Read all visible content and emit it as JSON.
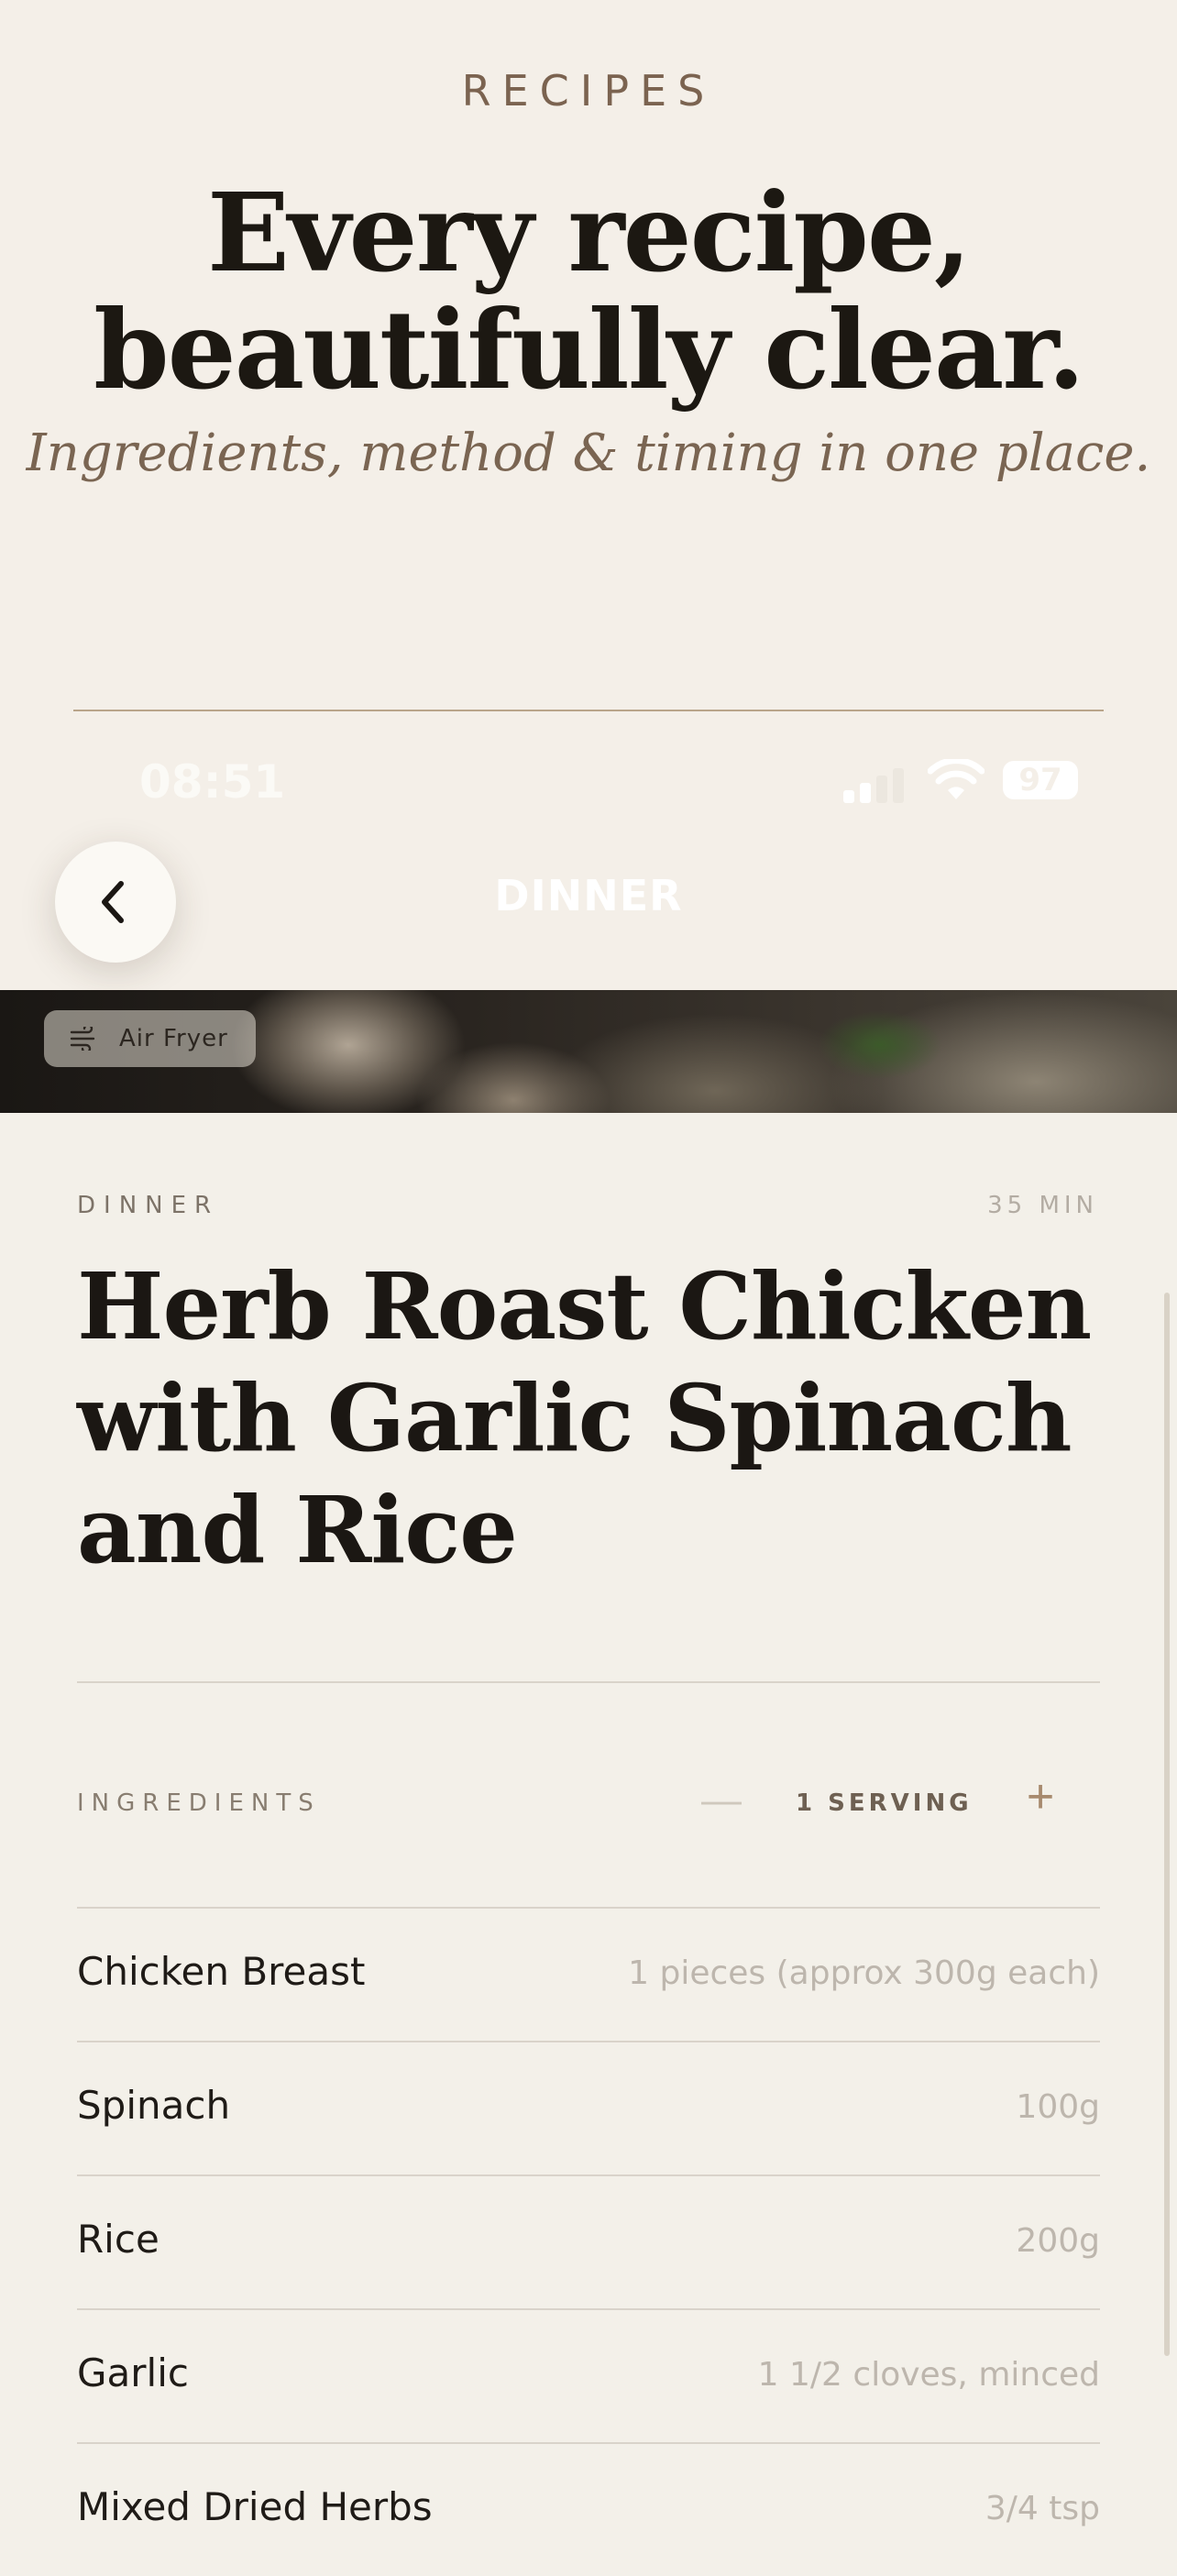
{
  "promo": {
    "eyebrow": "RECIPES",
    "headline_line1": "Every recipe,",
    "headline_line2": "beautifully clear.",
    "subhead": "Ingredients, method & timing in one place."
  },
  "status_bar": {
    "time": "08:51",
    "battery": "97"
  },
  "nav": {
    "back_icon": "chevron-left-icon",
    "title": "DINNER"
  },
  "hero": {
    "badge_icon": "air-fryer-icon",
    "badge_label": "Air Fryer"
  },
  "recipe": {
    "category": "DINNER",
    "time": "35 MIN",
    "title_line1": "Herb Roast Chicken",
    "title_line2": "with Garlic Spinach",
    "title_line3": "and Rice"
  },
  "ingredients": {
    "label": "INGREDIENTS",
    "minus": "—",
    "servings": "1 SERVING",
    "plus": "+",
    "items": [
      {
        "name": "Chicken Breast",
        "qty": "1 pieces (approx 300g each)"
      },
      {
        "name": "Spinach",
        "qty": "100g"
      },
      {
        "name": "Rice",
        "qty": "200g"
      },
      {
        "name": "Garlic",
        "qty": "1 1/2 cloves, minced"
      },
      {
        "name": "Mixed Dried Herbs",
        "qty": "3/4 tsp"
      }
    ]
  },
  "colors": {
    "background": "#f3f0e9",
    "accent": "#a78a6e",
    "text": "#1b1713"
  }
}
